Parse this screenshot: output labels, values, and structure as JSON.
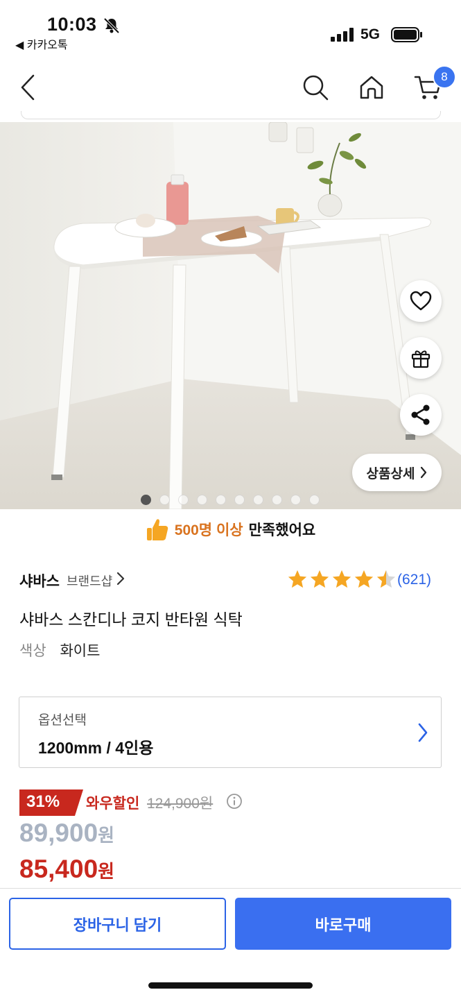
{
  "status_bar": {
    "time": "10:03",
    "back_app": "◀ 카카오톡",
    "network": "5G"
  },
  "header": {
    "cart_count": "8",
    "icons": [
      "back-icon",
      "search-icon",
      "home-icon",
      "cart-icon"
    ]
  },
  "gallery": {
    "detail_label": "상품상세",
    "dot_count": 10,
    "active_index": 0
  },
  "satisfaction": {
    "highlight": "500명 이상",
    "text": "만족했어요"
  },
  "product": {
    "brand": "샤바스",
    "brand_shop": "브랜드샵",
    "rating": 4.5,
    "review_count": "(621)",
    "title": "샤바스 스칸디나 코지 반타원 식탁",
    "color_label": "색상",
    "color_value": "화이트"
  },
  "option": {
    "label": "옵션선택",
    "value": "1200mm / 4인용"
  },
  "price": {
    "discount": "31%",
    "wow_label": "와우할인",
    "original": "124,900원",
    "price_1": "89,900",
    "price_2": "85,400",
    "won": "원"
  },
  "actions": {
    "cart": "장바구니 담기",
    "buy": "바로구매"
  },
  "colors": {
    "accent": "#3a6ff0",
    "sale": "#c8281e",
    "star": "#f5a623",
    "satisfy": "#d9731f"
  }
}
